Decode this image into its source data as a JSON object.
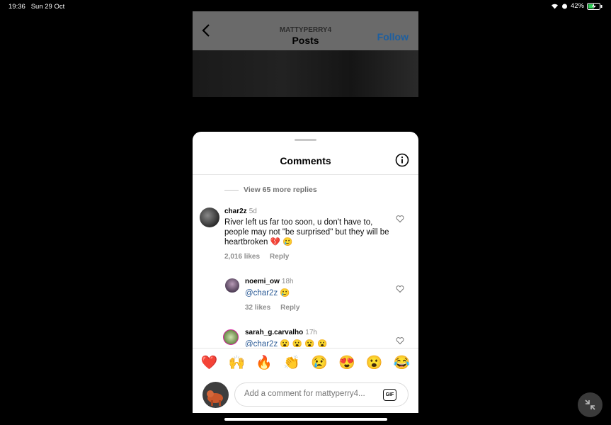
{
  "status_bar": {
    "time": "19:36",
    "date": "Sun 29 Oct",
    "battery": "42%"
  },
  "background_post": {
    "username": "MATTYPERRY4",
    "title": "Posts",
    "follow_label": "Follow"
  },
  "sheet": {
    "title": "Comments",
    "view_more": "View 65 more replies",
    "comments": [
      {
        "username": "char2z",
        "time": "5d",
        "text": "River left us far too soon, u don't have to, people may not \"be surprised\" but they will be heartbroken 💔 🥲",
        "likes": "2,016 likes",
        "reply": "Reply"
      },
      {
        "username": "noemi_ow",
        "time": "18h",
        "mention": "@char2z",
        "text": "🥲",
        "likes": "32 likes",
        "reply": "Reply"
      },
      {
        "username": "sarah_g.carvalho",
        "time": "17h",
        "mention": "@char2z",
        "text": "😮 😮 😮 😮"
      }
    ],
    "emojis": [
      "❤️",
      "🙌",
      "🔥",
      "👏",
      "😢",
      "😍",
      "😮",
      "😂"
    ],
    "input_placeholder": "Add a comment for mattyperry4...",
    "gif_label": "GIF"
  },
  "colors": {
    "accent": "#0095f6",
    "mention": "#2a5a96"
  }
}
